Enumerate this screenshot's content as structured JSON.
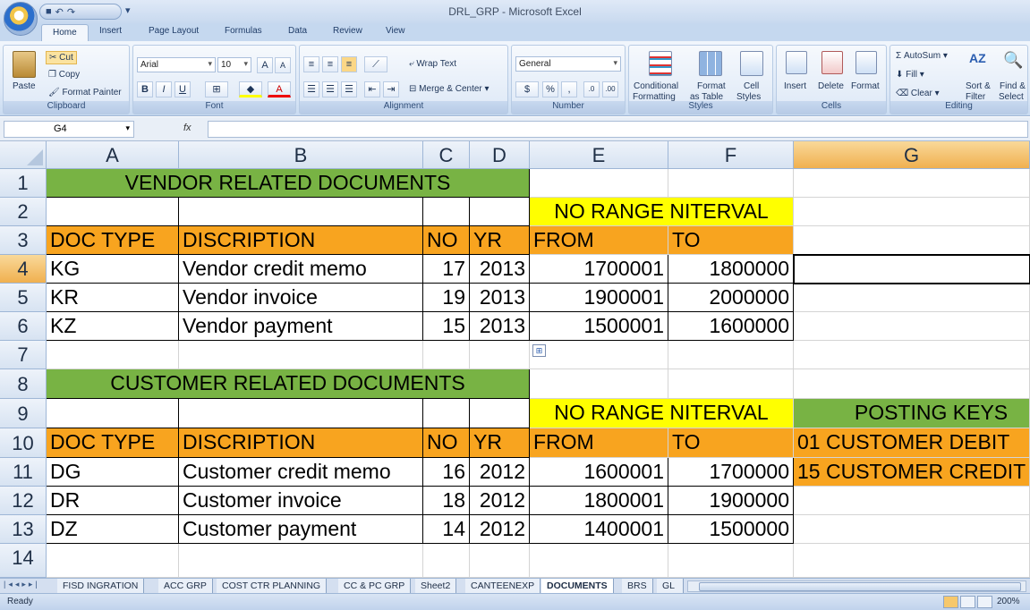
{
  "window": {
    "title": "DRL_GRP - Microsoft Excel"
  },
  "ribbon": {
    "tabs": [
      "Home",
      "Insert",
      "Page Layout",
      "Formulas",
      "Data",
      "Review",
      "View"
    ],
    "clipboard": {
      "paste": "Paste",
      "cut": "Cut",
      "copy": "Copy",
      "format_painter": "Format Painter",
      "label": "Clipboard"
    },
    "font": {
      "name": "Arial",
      "size": "10",
      "label": "Font"
    },
    "alignment": {
      "wrap_text": "Wrap Text",
      "merge_center": "Merge & Center",
      "label": "Alignment"
    },
    "number": {
      "format": "General",
      "label": "Number"
    },
    "styles": {
      "conditional": "Conditional",
      "conditional2": "Formatting",
      "format_as": "Format",
      "format_as2": "as Table",
      "cell": "Cell",
      "cell2": "Styles",
      "label": "Styles"
    },
    "cells": {
      "insert": "Insert",
      "delete": "Delete",
      "format": "Format",
      "label": "Cells"
    },
    "editing": {
      "autosum": "AutoSum",
      "fill": "Fill",
      "clear": "Clear",
      "sort": "Sort &",
      "sort2": "Filter",
      "find": "Find &",
      "find2": "Select",
      "label": "Editing"
    }
  },
  "formula_bar": {
    "name_box": "G4",
    "fx": "fx",
    "value": ""
  },
  "grid": {
    "columns": [
      "A",
      "B",
      "C",
      "D",
      "E",
      "F",
      "G"
    ],
    "selected_column": "G",
    "selected_row": 4,
    "rows": [
      1,
      2,
      3,
      4,
      5,
      6,
      7,
      8,
      9,
      10,
      11,
      12,
      13,
      14
    ],
    "vendor": {
      "title": "VENDOR RELATED DOCUMENTS",
      "range_header": "NO RANGE NITERVAL",
      "headers": [
        "DOC TYPE",
        "DISCRIPTION",
        "NO",
        "YR",
        "FROM",
        "TO"
      ],
      "rows": [
        [
          "KG",
          "Vendor credit memo",
          "17",
          "2013",
          "1700001",
          "1800000"
        ],
        [
          "KR",
          "Vendor invoice",
          "19",
          "2013",
          "1900001",
          "2000000"
        ],
        [
          "KZ",
          "Vendor payment",
          "15",
          "2013",
          "1500001",
          "1600000"
        ]
      ]
    },
    "customer": {
      "title": "CUSTOMER RELATED DOCUMENTS",
      "range_header": "NO RANGE NITERVAL",
      "headers": [
        "DOC TYPE",
        "DISCRIPTION",
        "NO",
        "YR",
        "FROM",
        "TO"
      ],
      "rows": [
        [
          "DG",
          "Customer credit memo",
          "16",
          "2012",
          "1600001",
          "1700000"
        ],
        [
          "DR",
          "Customer invoice",
          "18",
          "2012",
          "1800001",
          "1900000"
        ],
        [
          "DZ",
          "Customer payment",
          "14",
          "2012",
          "1400001",
          "1500000"
        ]
      ]
    },
    "posting_keys": {
      "title": "POSTING KEYS",
      "items": [
        "01 CUSTOMER DEBIT",
        "15 CUSTOMER CREDIT"
      ]
    }
  },
  "sheets": {
    "tabs": [
      "FISD INGRATION",
      "ACC GRP",
      "COST CTR PLANNING",
      "CC & PC GRP",
      "Sheet2",
      "CANTEENEXP",
      "DOCUMENTS",
      "BRS",
      "GL"
    ],
    "active": "DOCUMENTS"
  },
  "status": {
    "text": "Ready",
    "zoom": "200%"
  },
  "colors": {
    "green": "#78b344",
    "yellow": "#ffff00",
    "orange": "#f8a41f",
    "selection": "#f0b04f"
  }
}
